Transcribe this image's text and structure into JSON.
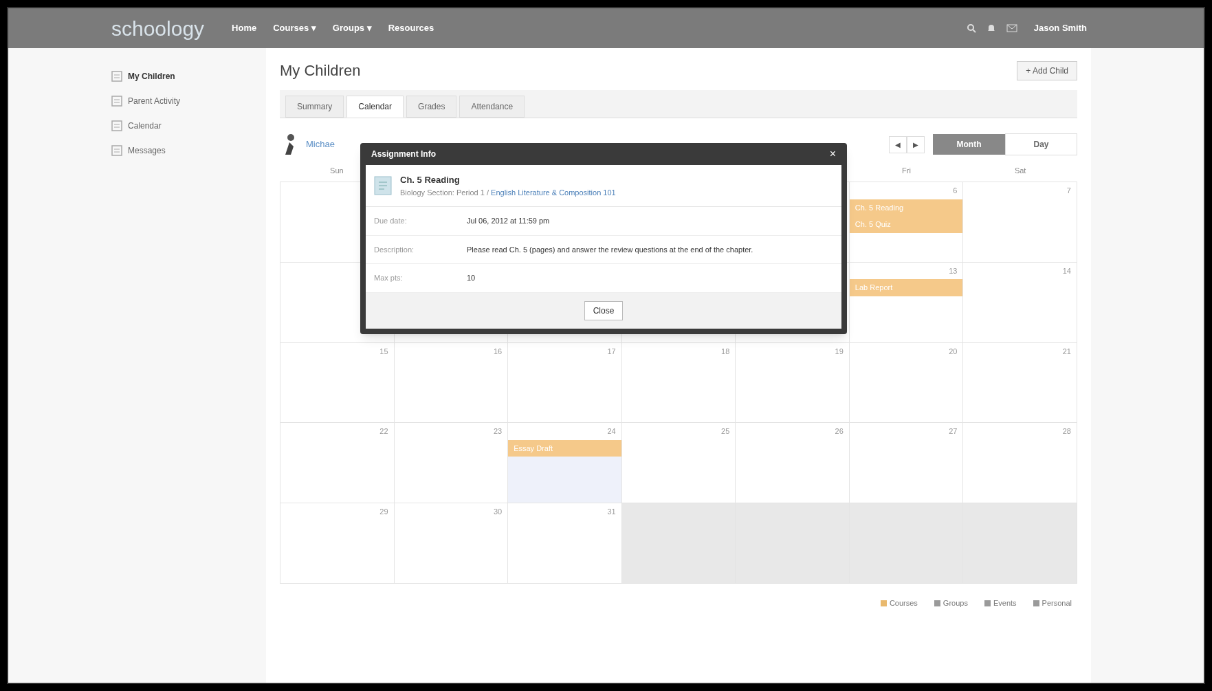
{
  "topbar": {
    "logo": "schoology",
    "nav": [
      {
        "label": "Home"
      },
      {
        "label": "Courses",
        "caret": "▾"
      },
      {
        "label": "Groups",
        "caret": "▾"
      },
      {
        "label": "Resources"
      }
    ],
    "user": "Jason Smith"
  },
  "sidebar": {
    "items": [
      {
        "label": "My Children",
        "selected": true
      },
      {
        "label": "Parent Activity",
        "selected": false
      },
      {
        "label": "Calendar",
        "selected": false
      },
      {
        "label": "Messages",
        "selected": false
      }
    ]
  },
  "page": {
    "title": "My Children",
    "add_button": "+ Add Child"
  },
  "tabs": [
    {
      "label": "Summary",
      "selected": false
    },
    {
      "label": "Calendar",
      "selected": true
    },
    {
      "label": "Grades",
      "selected": false
    },
    {
      "label": "Attendance",
      "selected": false
    }
  ],
  "calendar": {
    "child": "Michae",
    "prev": "◀",
    "next": "▶",
    "views": [
      {
        "label": "Month",
        "selected": true
      },
      {
        "label": "Day",
        "selected": false
      }
    ],
    "weeks": [
      [
        {
          "kind": "day",
          "weekday": "Sun",
          "in_month": true
        },
        {
          "kind": "covered"
        },
        {
          "kind": "covered"
        },
        {
          "kind": "covered"
        },
        {
          "kind": "day",
          "in_month": true
        },
        {
          "kind": "day",
          "weekday": "Fri",
          "day": "6",
          "in_month": true,
          "events": [
            {
              "title": "Ch. 5 Reading",
              "color": "#f5c98a"
            },
            {
              "title": "Ch. 5 Quiz",
              "color": "#f5c98a"
            }
          ]
        },
        {
          "kind": "day",
          "weekday": "Sat",
          "day": "7",
          "in_month": true
        }
      ],
      [
        {
          "kind": "day",
          "in_month": true
        },
        {
          "kind": "covered"
        },
        {
          "kind": "covered"
        },
        {
          "kind": "covered"
        },
        {
          "kind": "day",
          "in_month": true
        },
        {
          "kind": "day",
          "day": "13",
          "in_month": true,
          "events": [
            {
              "title": "Lab Report",
              "color": "#f5c98a"
            }
          ]
        },
        {
          "kind": "day",
          "day": "14",
          "in_month": true
        }
      ],
      [
        {
          "kind": "day",
          "day": "15",
          "in_month": true
        },
        {
          "kind": "day",
          "day": "16",
          "in_month": true
        },
        {
          "kind": "day",
          "day": "17",
          "in_month": true
        },
        {
          "kind": "day",
          "day": "18",
          "in_month": true
        },
        {
          "kind": "day",
          "day": "19",
          "in_month": true
        },
        {
          "kind": "day",
          "day": "20",
          "in_month": true
        },
        {
          "kind": "day",
          "day": "21",
          "in_month": true
        }
      ],
      [
        {
          "kind": "day",
          "day": "22",
          "in_month": true
        },
        {
          "kind": "day",
          "day": "23",
          "in_month": true
        },
        {
          "kind": "day",
          "day": "24",
          "in_month": true,
          "today": true,
          "events": [
            {
              "title": "Essay Draft",
              "color": "#f5c98a"
            }
          ]
        },
        {
          "kind": "day",
          "day": "25",
          "in_month": true
        },
        {
          "kind": "day",
          "day": "26",
          "in_month": true
        },
        {
          "kind": "day",
          "day": "27",
          "in_month": true
        },
        {
          "kind": "day",
          "day": "28",
          "in_month": true
        }
      ],
      [
        {
          "kind": "day",
          "day": "29",
          "in_month": true
        },
        {
          "kind": "day",
          "day": "30",
          "in_month": true
        },
        {
          "kind": "day",
          "day": "31",
          "in_month": true
        },
        {
          "kind": "day",
          "in_month": false
        },
        {
          "kind": "day",
          "in_month": false
        },
        {
          "kind": "day",
          "in_month": false
        },
        {
          "kind": "day",
          "in_month": false
        }
      ]
    ],
    "legend": [
      {
        "label": "Courses",
        "color": "#e9b96e"
      },
      {
        "label": "Groups",
        "color": "#9a9a9a"
      },
      {
        "label": "Events",
        "color": "#9a9a9a"
      },
      {
        "label": "Personal",
        "color": "#9a9a9a"
      }
    ]
  },
  "dialog": {
    "title": "Assignment Info",
    "close": "×",
    "name": "Ch. 5 Reading",
    "section": "Biology Section: Period 1 / ",
    "course": "English Literature & Composition 101",
    "fields": [
      {
        "label": "Due date:",
        "value": "Jul 06, 2012 at 11:59 pm"
      },
      {
        "label": "Description:",
        "value": "Please read Ch. 5 (pages) and answer the review questions at the end of the chapter."
      },
      {
        "label": "Max pts:",
        "value": "10"
      }
    ],
    "button": "Close"
  }
}
